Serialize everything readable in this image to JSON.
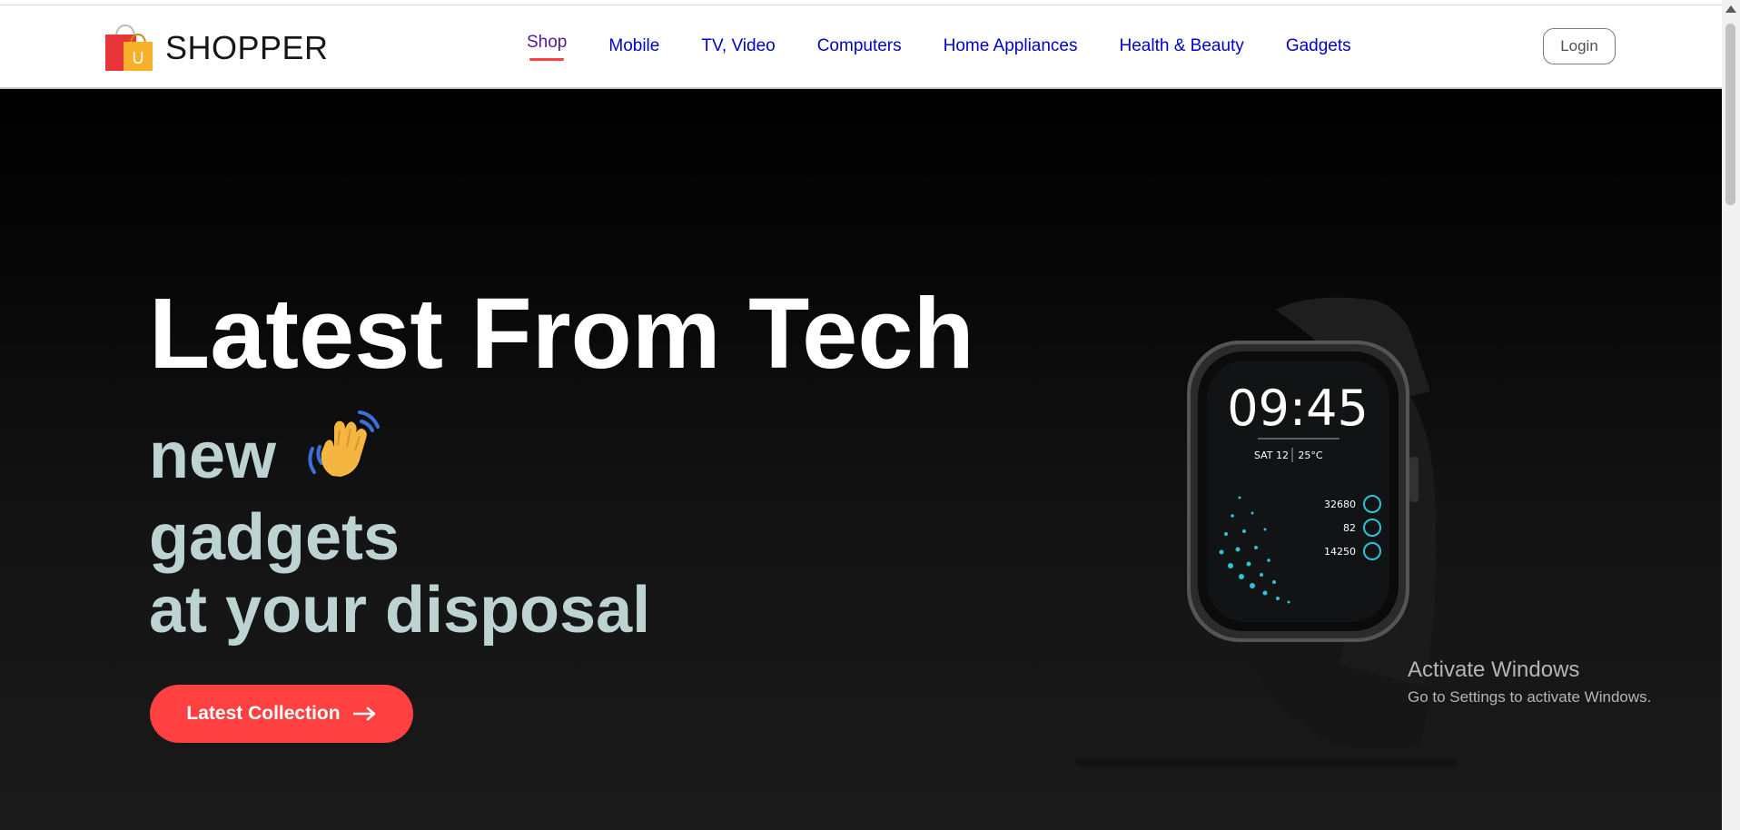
{
  "brand": {
    "name": "SHOPPER",
    "logo_icon": "shopping-bag-icon",
    "logo_letter": "U"
  },
  "nav": {
    "items": [
      {
        "label": "Shop",
        "active": true
      },
      {
        "label": "Mobile"
      },
      {
        "label": "TV, Video"
      },
      {
        "label": "Computers"
      },
      {
        "label": "Home Appliances"
      },
      {
        "label": "Health & Beauty"
      },
      {
        "label": "Gadgets"
      }
    ],
    "login_label": "Login"
  },
  "hero": {
    "title": "Latest From Tech",
    "line1": "new",
    "hand_icon": "waving-hand-icon",
    "line2": "gadgets",
    "line3": "at your disposal",
    "cta_label": "Latest Collection",
    "cta_icon": "arrow-right-icon"
  },
  "watch": {
    "image": "smartwatch",
    "time": "09:45",
    "date": "SAT 12",
    "temp": "25°C",
    "stats": [
      "32680",
      "82",
      "14250"
    ]
  },
  "overlay": {
    "title": "Activate Windows",
    "subtitle": "Go to Settings to activate Windows."
  },
  "colors": {
    "accent": "#ff4141",
    "hero_bg": "#000000",
    "subtitle": "#bdd3d2",
    "nav_link": "#0000cc",
    "nav_active": "#551a8b"
  }
}
